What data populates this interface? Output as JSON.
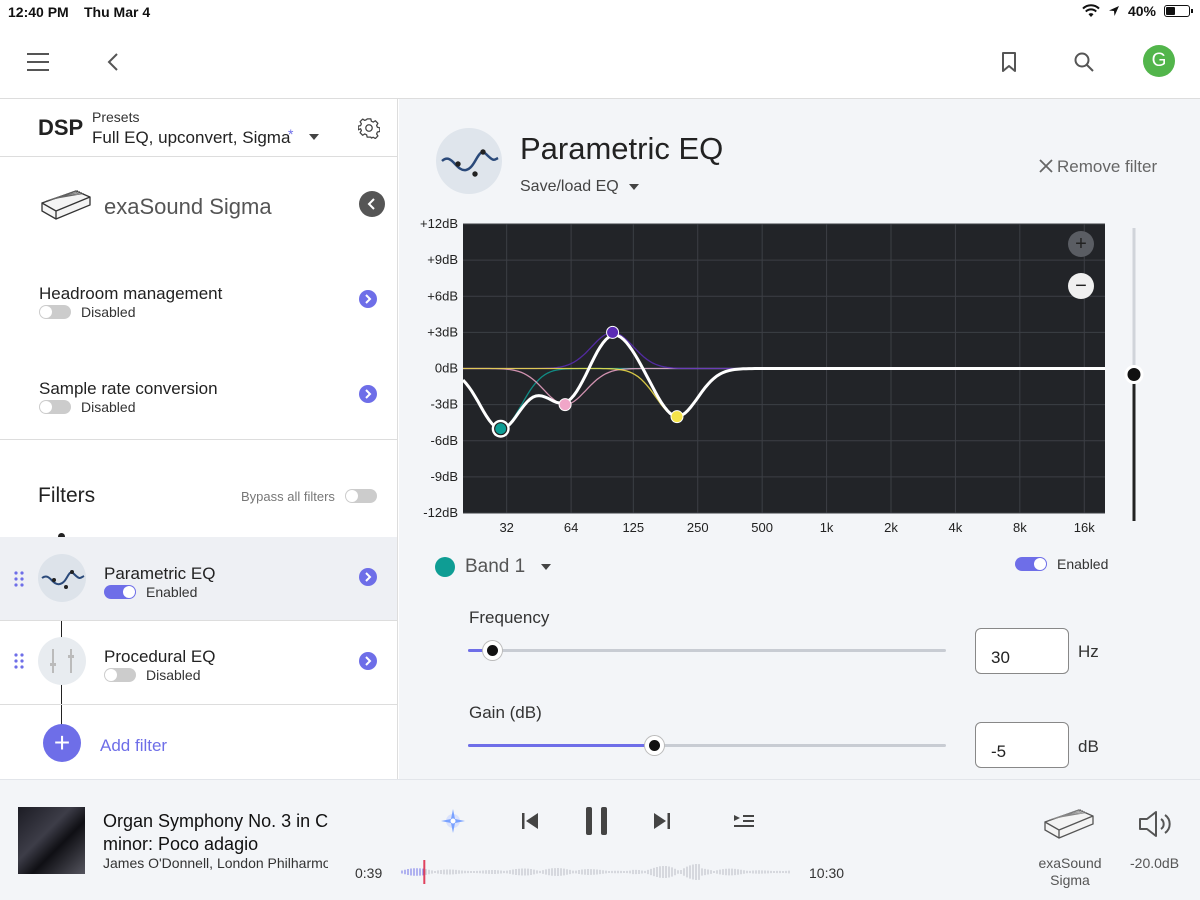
{
  "status_bar": {
    "time": "12:40 PM",
    "date": "Thu Mar 4",
    "battery": "40%",
    "battery_level": 0.4
  },
  "top_bar": {
    "avatar_letter": "G",
    "icons": [
      "menu-icon",
      "back-icon",
      "bookmark-icon",
      "search-icon"
    ]
  },
  "dsp": {
    "title": "DSP",
    "presets_label": "Presets",
    "preset_value": "Full EQ, upconvert, Sigma",
    "preset_modified_mark": "*",
    "device_name": "exaSound Sigma",
    "settings": [
      {
        "title": "Headroom management",
        "status": "Disabled",
        "enabled": false
      },
      {
        "title": "Sample rate conversion",
        "status": "Disabled",
        "enabled": false
      }
    ],
    "filters_title": "Filters",
    "bypass_label": "Bypass all filters",
    "bypass_enabled": false,
    "filters": [
      {
        "name": "Parametric EQ",
        "status": "Enabled",
        "enabled": true,
        "selected": true
      },
      {
        "name": "Procedural EQ",
        "status": "Disabled",
        "enabled": false,
        "selected": false
      }
    ],
    "add_filter_label": "Add filter"
  },
  "editor": {
    "title": "Parametric EQ",
    "save_load_label": "Save/load EQ",
    "remove_label": "Remove filter",
    "band_label": "Band 1",
    "band_color": "#0e9d94",
    "band_enabled_label": "Enabled",
    "band_enabled": true,
    "frequency_label": "Frequency",
    "frequency_value": "30",
    "frequency_unit": "Hz",
    "frequency_slider_fraction": 0.05,
    "gain_label": "Gain (dB)",
    "gain_value": "-5",
    "gain_unit": "dB",
    "gain_slider_fraction": 0.39,
    "vertical_slider_fraction": 0.5,
    "zoom_in_symbol": "+",
    "zoom_out_symbol": "−"
  },
  "chart_data": {
    "type": "line",
    "y_tick_labels": [
      "+12dB",
      "+9dB",
      "+6dB",
      "+3dB",
      "0dB",
      "-3dB",
      "-6dB",
      "-9dB",
      "-12dB"
    ],
    "ylim": [
      -12,
      12
    ],
    "x_tick_labels": [
      "32",
      "64",
      "125",
      "250",
      "500",
      "1k",
      "2k",
      "4k",
      "8k",
      "16k"
    ],
    "x_tick_values": [
      32,
      64,
      125,
      250,
      500,
      1000,
      2000,
      4000,
      8000,
      16000
    ],
    "xlim": [
      20,
      20000
    ],
    "x_scale": "log",
    "bands": [
      {
        "freq": 30,
        "gain": -5,
        "color": "#0e9d94"
      },
      {
        "freq": 60,
        "gain": -3,
        "color": "#f0a6c8"
      },
      {
        "freq": 100,
        "gain": 3,
        "color": "#5b2bb5"
      },
      {
        "freq": 200,
        "gain": -4,
        "color": "#f5e34a"
      }
    ],
    "grid": true,
    "background": "#222428",
    "curve_color": "#ffffff"
  },
  "player": {
    "track_title": "Organ Symphony No. 3 in C minor: Poco adagio",
    "artist": "James O'Donnell, London Philharmonic Orchestra",
    "elapsed": "0:39",
    "duration": "10:30",
    "progress_fraction": 0.062,
    "device_label": "exaSound Sigma",
    "volume_label": "-20.0dB"
  }
}
